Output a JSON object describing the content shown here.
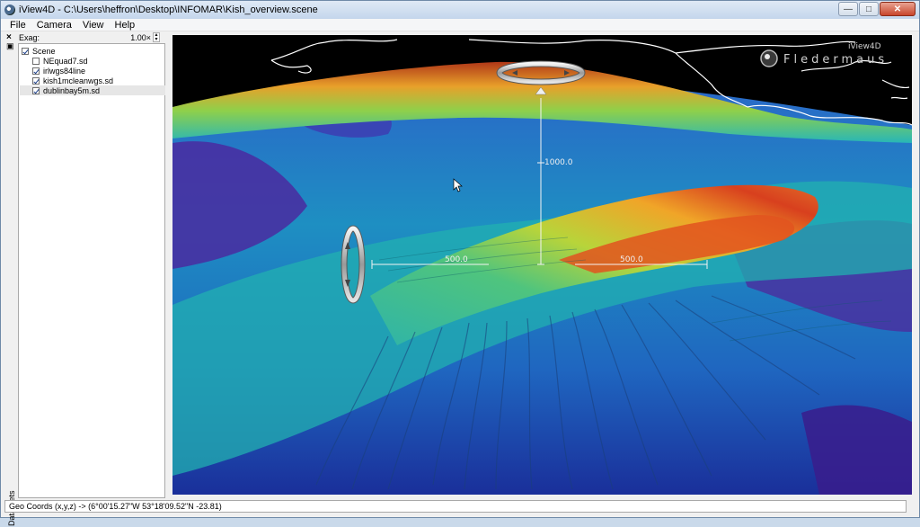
{
  "window": {
    "title": "iView4D - C:\\Users\\heffron\\Desktop\\INFOMAR\\Kish_overview.scene",
    "controls": [
      "minimize",
      "maximize",
      "close"
    ]
  },
  "menu": [
    "File",
    "Camera",
    "View",
    "Help"
  ],
  "panel": {
    "exag_label": "Exag:",
    "exag_value": "1.00×",
    "side_tab": "Data Sets",
    "tree": [
      {
        "label": "Scene",
        "checked": true,
        "level": 0
      },
      {
        "label": "NEquad7.sd",
        "checked": false,
        "level": 1
      },
      {
        "label": "irlwgs84line",
        "checked": true,
        "level": 1
      },
      {
        "label": "kish1mcleanwgs.sd",
        "checked": true,
        "level": 1
      },
      {
        "label": "dublinbay5m.sd",
        "checked": true,
        "level": 1,
        "selected": true
      }
    ]
  },
  "viewport": {
    "brand_name": "Fledermaus",
    "brand_product": "iView4D",
    "scale_vertical": "1000.0",
    "scale_left": "500.0",
    "scale_right": "500.0"
  },
  "status": {
    "geo_coords": "Geo Coords (x,y,z) -> (6°00'15.27\"W 53°18'09.52\"N -23.81)"
  },
  "icons": {
    "app": "globe-icon",
    "rotate_horizontal": "horizontal-rotate-ring-icon",
    "rotate_vertical": "vertical-rotate-ring-icon",
    "cursor": "mouse-pointer-icon"
  }
}
